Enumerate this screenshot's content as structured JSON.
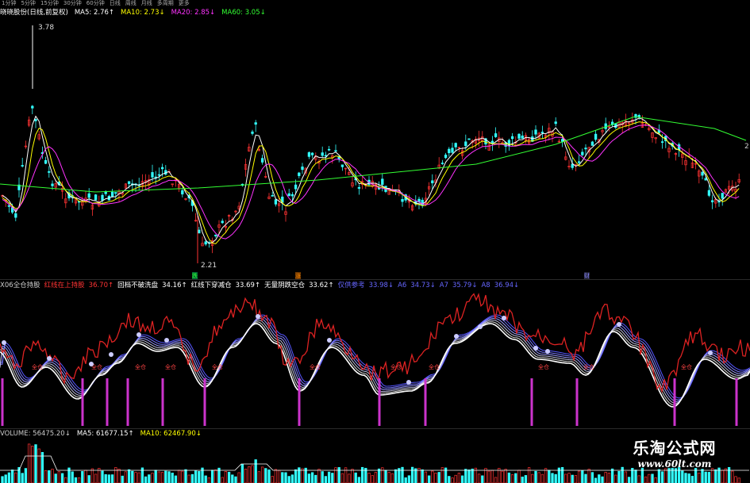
{
  "period_bar": [
    "1分钟",
    "5分钟",
    "15分钟",
    "30分钟",
    "60分钟",
    "日线",
    "周线",
    "月线",
    "多周期",
    "更多"
  ],
  "price_legend": {
    "symbol": "晓晓股份(日线,前复权)",
    "ma5": "MA5: 2.76↑",
    "ma10": "MA10: 2.73↓",
    "ma20": "MA20: 2.85↓",
    "ma60": "MA60: 3.05↓",
    "colors": {
      "ma5": "#ffffff",
      "ma10": "#ffff00",
      "ma20": "#ff33ff",
      "ma60": "#33ff33"
    }
  },
  "price_panel": {
    "high_label": "3.78",
    "low_label": "2.21",
    "right_label": "2",
    "marker_labels": [
      "跌",
      "涨",
      "财"
    ]
  },
  "indicator_legend": {
    "name": "X06全仓持股",
    "items": [
      {
        "text": "红线在上持股",
        "value": "36.70↑",
        "color": "#ff3333"
      },
      {
        "text": "回档不破洗盘",
        "value": "34.16↑",
        "color": "#ffffff"
      },
      {
        "text": "红线下穿减仓",
        "value": "33.69↑",
        "color": "#ffffff"
      },
      {
        "text": "无量阴跌空仓",
        "value": "33.62↑",
        "color": "#ffffff"
      },
      {
        "text": "仅供参考",
        "value": "33.98↓",
        "color": "#6666ff"
      },
      {
        "text": "A6",
        "value": "34.73↓",
        "color": "#6666ff"
      },
      {
        "text": "A7",
        "value": "35.79↓",
        "color": "#6666ff"
      },
      {
        "text": "A8",
        "value": "36.94↓",
        "color": "#6666ff"
      }
    ],
    "signal_label": "全仓"
  },
  "volume_legend": {
    "volume": "VOLUME: 56475.20↓",
    "ma5": "MA5: 61677.15↑",
    "ma10": "MA10: 62467.90↓"
  },
  "watermark": {
    "title": "乐淘公式网",
    "url": "www.60lt.com"
  }
}
